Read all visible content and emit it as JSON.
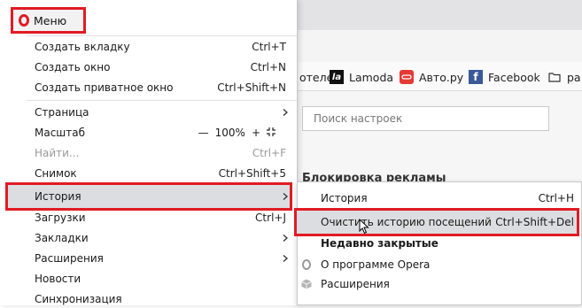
{
  "background": {
    "bookmarks": [
      {
        "label": "отеле",
        "icon": "none"
      },
      {
        "label": "Lamoda",
        "icon": "lamoda-icon",
        "badge": "la"
      },
      {
        "label": "Авто.ру",
        "icon": "auto-ru-icon"
      },
      {
        "label": "Facebook",
        "icon": "facebook-icon",
        "badge": "f"
      },
      {
        "label": "ра",
        "icon": "folder-icon"
      }
    ],
    "search_placeholder": "Поиск настроек",
    "section_title": "Блокировка рекламы"
  },
  "menu": {
    "header_label": "Меню",
    "items": [
      {
        "label": "Создать вкладку",
        "shortcut": "Ctrl+T"
      },
      {
        "label": "Создать окно",
        "shortcut": "Ctrl+N"
      },
      {
        "label": "Создать приватное окно",
        "shortcut": "Ctrl+Shift+N"
      },
      {
        "label": "Страница",
        "shortcut": ""
      },
      {
        "label": "Масштаб",
        "shortcut": ""
      },
      {
        "label": "Найти...",
        "shortcut": "Ctrl+F",
        "disabled": true
      },
      {
        "label": "Снимок",
        "shortcut": "Ctrl+Shift+5"
      },
      {
        "label": "История",
        "shortcut": ""
      },
      {
        "label": "Загрузки",
        "shortcut": "Ctrl+J"
      },
      {
        "label": "Закладки",
        "shortcut": ""
      },
      {
        "label": "Расширения",
        "shortcut": ""
      },
      {
        "label": "Новости",
        "shortcut": ""
      },
      {
        "label": "Синхронизация",
        "shortcut": ""
      }
    ],
    "zoom": {
      "minus": "—",
      "value": "100%",
      "plus": "+"
    }
  },
  "submenu": {
    "items": [
      {
        "label": "История",
        "shortcut": "Ctrl+H"
      },
      {
        "label": "Очистить историю посещений",
        "shortcut": "Ctrl+Shift+Del"
      },
      {
        "label": "Недавно закрытые",
        "shortcut": ""
      },
      {
        "label": "О программе Opera",
        "shortcut": ""
      },
      {
        "label": "Расширения",
        "shortcut": ""
      }
    ]
  },
  "colors": {
    "highlight_border": "#e11b24",
    "highlight_bg": "#dcdde0",
    "opera_red": "#e11b24"
  }
}
